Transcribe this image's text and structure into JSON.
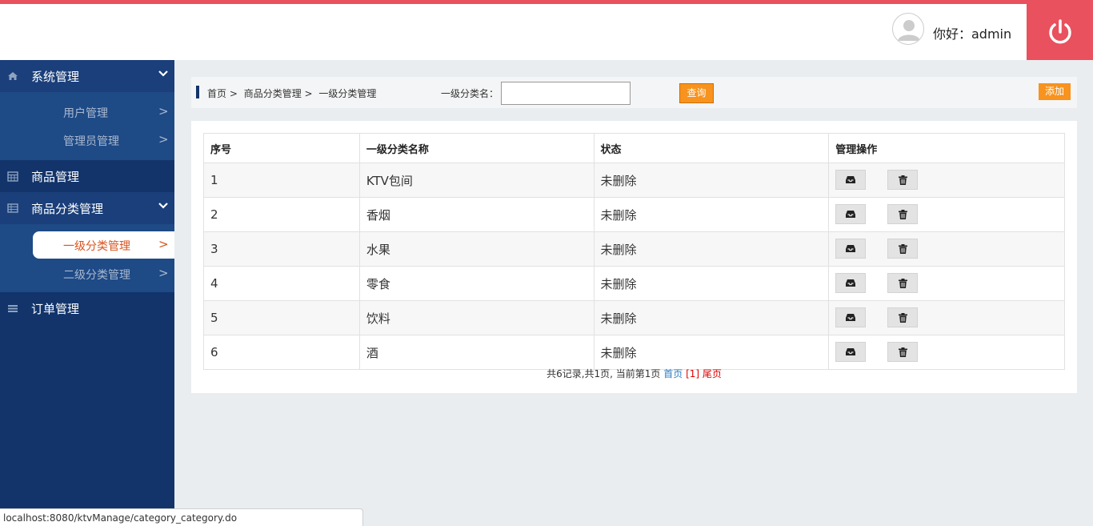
{
  "header": {
    "greeting": "你好：admin",
    "accent_color": "#e8515d",
    "power_icon": "power-icon",
    "avatar_icon": "user-avatar-icon"
  },
  "sidebar": {
    "bg_color": "#12346b",
    "groups": [
      {
        "label": "系统管理",
        "icon": "home-icon",
        "expanded": true,
        "items": [
          {
            "label": "用户管理",
            "arrow": ">"
          },
          {
            "label": "管理员管理",
            "arrow": ">"
          }
        ]
      },
      {
        "label": "商品管理",
        "icon": "calendar-grid-icon",
        "expanded": false
      },
      {
        "label": "商品分类管理",
        "icon": "table-icon",
        "expanded": true,
        "items": [
          {
            "label": "一级分类管理",
            "arrow": ">",
            "active": true
          },
          {
            "label": "二级分类管理",
            "arrow": ">"
          }
        ]
      },
      {
        "label": "订单管理",
        "icon": "list-icon",
        "expanded": false
      }
    ]
  },
  "toolbar": {
    "breadcrumb": [
      "首页 >",
      "商品分类管理 >",
      "一级分类管理"
    ],
    "search_label": "一级分类名：",
    "search_value": "",
    "query_label": "查询",
    "add_label": "添加",
    "button_color": "#f7931e"
  },
  "table": {
    "headers": [
      "序号",
      "一级分类名称",
      "状态",
      "管理操作"
    ],
    "rows": [
      {
        "id": "1",
        "name": "KTV包间",
        "status": "未删除"
      },
      {
        "id": "2",
        "name": "香烟",
        "status": "未删除"
      },
      {
        "id": "3",
        "name": "水果",
        "status": "未删除"
      },
      {
        "id": "4",
        "name": "零食",
        "status": "未删除"
      },
      {
        "id": "5",
        "name": "饮料",
        "status": "未删除"
      },
      {
        "id": "6",
        "name": "酒",
        "status": "未删除"
      }
    ],
    "edit_icon": "inbox-edit-icon",
    "delete_icon": "trash-icon"
  },
  "pager": {
    "summary": "共6记录,共1页, 当前第1页",
    "first": "首页",
    "current": "[1]",
    "last": "尾页"
  },
  "statusbar": {
    "url": "localhost:8080/ktvManage/category_category.do"
  }
}
